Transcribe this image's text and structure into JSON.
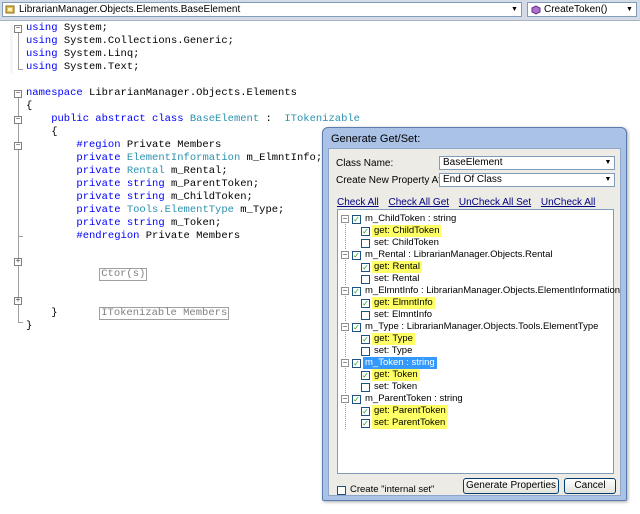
{
  "navbar": {
    "class_combo": "LibrarianManager.Objects.Elements.BaseElement",
    "member_combo": "CreateToken()"
  },
  "code": {
    "lines": [
      [
        [
          "kw",
          "using"
        ],
        [
          "",
          "System;"
        ]
      ],
      [
        [
          "kw",
          "using"
        ],
        [
          "",
          "System.Collections.Generic;"
        ]
      ],
      [
        [
          "kw",
          "using"
        ],
        [
          "",
          "System.Linq;"
        ]
      ],
      [
        [
          "kw",
          "using"
        ],
        [
          "",
          "System.Text;"
        ]
      ],
      [],
      [
        [
          "kw",
          "namespace"
        ],
        [
          "",
          "LibrarianManager.Objects.Elements"
        ]
      ],
      [
        [
          "",
          "{"
        ]
      ],
      [
        [
          "kw",
          "    public abstract class"
        ],
        [
          "ty",
          "BaseElement"
        ],
        [
          "",
          " : "
        ],
        [
          "ty",
          "ITokenizable"
        ]
      ],
      [
        [
          "",
          "    {"
        ]
      ],
      [
        [
          "kw",
          "        #region"
        ],
        [
          "",
          " Private Members"
        ]
      ],
      [
        [
          "kw",
          "        private"
        ],
        [
          "ty",
          "ElementInformation"
        ],
        [
          "",
          " m_ElmntInfo;"
        ]
      ],
      [
        [
          "kw",
          "        private"
        ],
        [
          "ty",
          "Rental"
        ],
        [
          "",
          " m_Rental;"
        ]
      ],
      [
        [
          "kw",
          "        private string"
        ],
        [
          "",
          "m_ParentToken;"
        ]
      ],
      [
        [
          "kw",
          "        private string"
        ],
        [
          "",
          "m_ChildToken;"
        ]
      ],
      [
        [
          "kw",
          "        private"
        ],
        [
          "ty",
          "Tools.ElementType"
        ],
        [
          "",
          " m_Type;"
        ]
      ],
      [
        [
          "kw",
          "        private string"
        ],
        [
          "",
          "m_Token;"
        ]
      ],
      [
        [
          "kw",
          "        #endregion"
        ],
        [
          "",
          " Private Members"
        ]
      ]
    ],
    "ctor_region": "Ctor(s)",
    "itok_region": "ITokenizable Members",
    "close_class": "    }",
    "close_ns": "}"
  },
  "dialog": {
    "title": "Generate Get/Set:",
    "class_name_label": "Class Name:",
    "class_name_value": "BaseElement",
    "property_at_label": "Create New Property At:",
    "property_at_value": "End Of Class",
    "links": [
      "Check All",
      "Check All Get",
      "UnCheck All Set",
      "UnCheck All"
    ],
    "tree": [
      {
        "label": "m_ChildToken : string",
        "checked": true,
        "highlight": "",
        "children": [
          {
            "label": "get: ChildToken",
            "checked": true,
            "highlight": "yellow"
          },
          {
            "label": "set: ChildToken",
            "checked": false,
            "highlight": ""
          }
        ]
      },
      {
        "label": "m_Rental : LibrarianManager.Objects.Rental",
        "checked": true,
        "highlight": "",
        "children": [
          {
            "label": "get: Rental",
            "checked": true,
            "highlight": "yellow"
          },
          {
            "label": "set: Rental",
            "checked": false,
            "highlight": ""
          }
        ]
      },
      {
        "label": "m_ElmntInfo : LibrarianManager.Objects.ElementInformation",
        "checked": true,
        "highlight": "",
        "children": [
          {
            "label": "get: ElmntInfo",
            "checked": true,
            "highlight": "yellow"
          },
          {
            "label": "set: ElmntInfo",
            "checked": false,
            "highlight": ""
          }
        ]
      },
      {
        "label": "m_Type : LibrarianManager.Objects.Tools.ElementType",
        "checked": true,
        "highlight": "",
        "children": [
          {
            "label": "get: Type",
            "checked": true,
            "highlight": "yellow"
          },
          {
            "label": "set: Type",
            "checked": false,
            "highlight": ""
          }
        ]
      },
      {
        "label": "m_Token : string",
        "checked": true,
        "highlight": "blue",
        "children": [
          {
            "label": "get: Token",
            "checked": true,
            "highlight": "yellow"
          },
          {
            "label": "set: Token",
            "checked": false,
            "highlight": ""
          }
        ]
      },
      {
        "label": "m_ParentToken : string",
        "checked": true,
        "highlight": "",
        "children": [
          {
            "label": "get: ParentToken",
            "checked": true,
            "highlight": "yellow"
          },
          {
            "label": "set: ParentToken",
            "checked": true,
            "highlight": "yellow"
          }
        ]
      }
    ],
    "internal_set_label": "Create \"internal set\"",
    "internal_set_checked": false,
    "generate_button": "Generate Properties",
    "cancel_button": "Cancel"
  },
  "colors": {
    "keyword": "#0000ff",
    "type": "#2b91af",
    "highlight_yellow": "#ffff66",
    "highlight_blue": "#3399ff"
  }
}
